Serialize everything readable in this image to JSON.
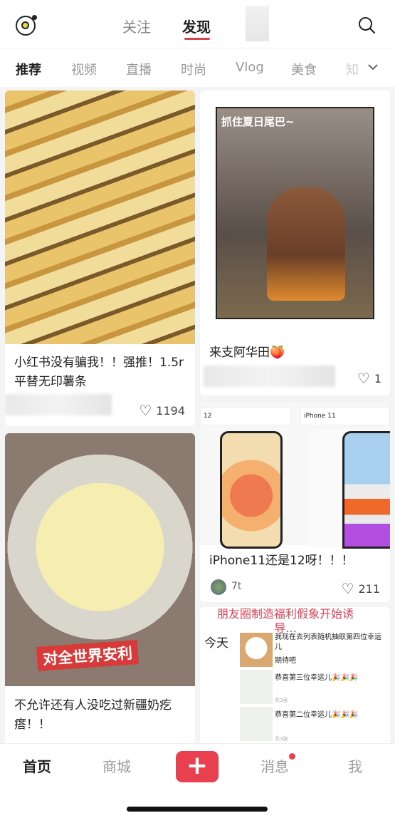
{
  "header": {
    "tabs": [
      {
        "label": "关注",
        "active": false
      },
      {
        "label": "发现",
        "active": true
      }
    ]
  },
  "categories": [
    {
      "label": "推荐",
      "active": true
    },
    {
      "label": "视频"
    },
    {
      "label": "直播"
    },
    {
      "label": "时尚"
    },
    {
      "label": "Vlog"
    },
    {
      "label": "美食"
    },
    {
      "label": "知"
    }
  ],
  "feed": {
    "left": [
      {
        "title": "小红书没有骗我！！强推！1.5r 平替无印薯条",
        "likes": "1194"
      },
      {
        "title": "不允许还有人没吃过新疆奶疙瘩！！",
        "image_caption": "对全世界安利"
      }
    ],
    "right": [
      {
        "title": "来支阿华田🍑",
        "likes": "1",
        "image_caption": "抓住夏日尾巴~"
      },
      {
        "title": "iPhone11还是12呀！！！",
        "author": "7t",
        "likes": "211",
        "image_labels": [
          "12",
          "iPhone 11"
        ]
      },
      {
        "image_title": "朋友圈制造福利假象开始诱导...",
        "image_lines": [
          "今天",
          "我现在去列表随机抽取第四位幸运儿",
          "期待吧",
          "恭喜第三位幸运儿🎉🎉🎉",
          "共3张",
          "恭喜第二位幸运儿🎉🎉🎉",
          "共3张"
        ]
      }
    ]
  },
  "nav": {
    "items": [
      {
        "label": "首页",
        "active": true
      },
      {
        "label": "商城"
      },
      {
        "label": "消息",
        "badge": true
      },
      {
        "label": "我"
      }
    ],
    "accent": "#e8404f"
  }
}
